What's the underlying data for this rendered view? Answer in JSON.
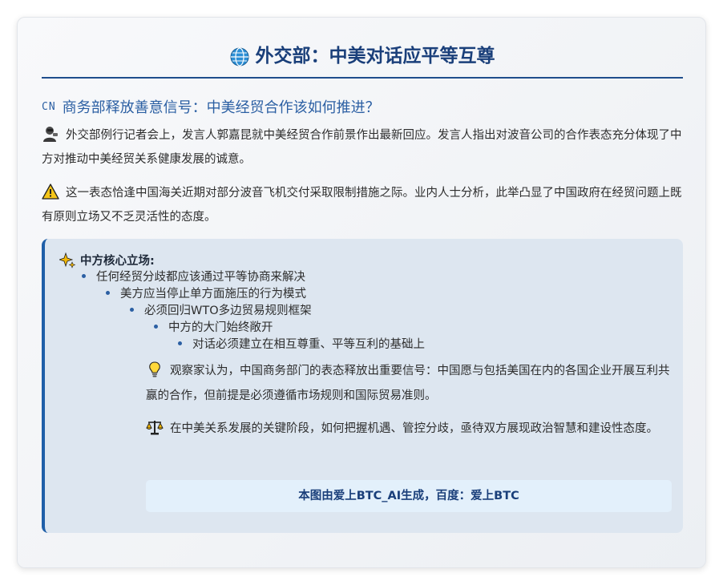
{
  "header": {
    "title": "外交部：中美对话应平等互尊",
    "icon": "globe-icon"
  },
  "subtitle": {
    "flag": "CN",
    "text": "商务部释放善意信号：中美经贸合作该如何推进？"
  },
  "paragraphs": [
    {
      "icon": "spokesperson-icon",
      "text": "外交部例行记者会上，发言人郭嘉昆就中美经贸合作前景作出最新回应。发言人指出对波音公司的合作表态充分体现了中方对推动中美经贸关系健康发展的诚意。"
    },
    {
      "icon": "warning-icon",
      "text": "这一表态恰逢中国海关近期对部分波音飞机交付采取限制措施之际。业内人士分析，此举凸显了中国政府在经贸问题上既有原则立场又不乏灵活性的态度。"
    }
  ],
  "panel": {
    "title": "中方核心立场:",
    "icon": "sparkle-icon",
    "bullets": [
      "任何经贸分歧都应该通过平等协商来解决",
      "美方应当停止单方面施压的行为模式",
      "必须回归WTO多边贸易规则框架",
      "中方的大门始终敞开",
      "对话必须建立在相互尊重、平等互利的基础上"
    ],
    "notes": [
      {
        "icon": "lightbulb-icon",
        "text": "观察家认为，中国商务部门的表态释放出重要信号：中国愿与包括美国在内的各国企业开展互利共赢的合作，但前提是必须遵循市场规则和国际贸易准则。"
      },
      {
        "icon": "scales-icon",
        "text": "在中美关系发展的关键阶段，如何把握机遇、管控分歧，亟待双方展现政治智慧和建设性态度。"
      }
    ],
    "footer": "本图由爱上BTC_AI生成，百度：爱上BTC"
  },
  "colors": {
    "accent": "#1f4e8c",
    "panel_bg": "#dde6f0",
    "footer_bg": "#e3f0fb"
  }
}
